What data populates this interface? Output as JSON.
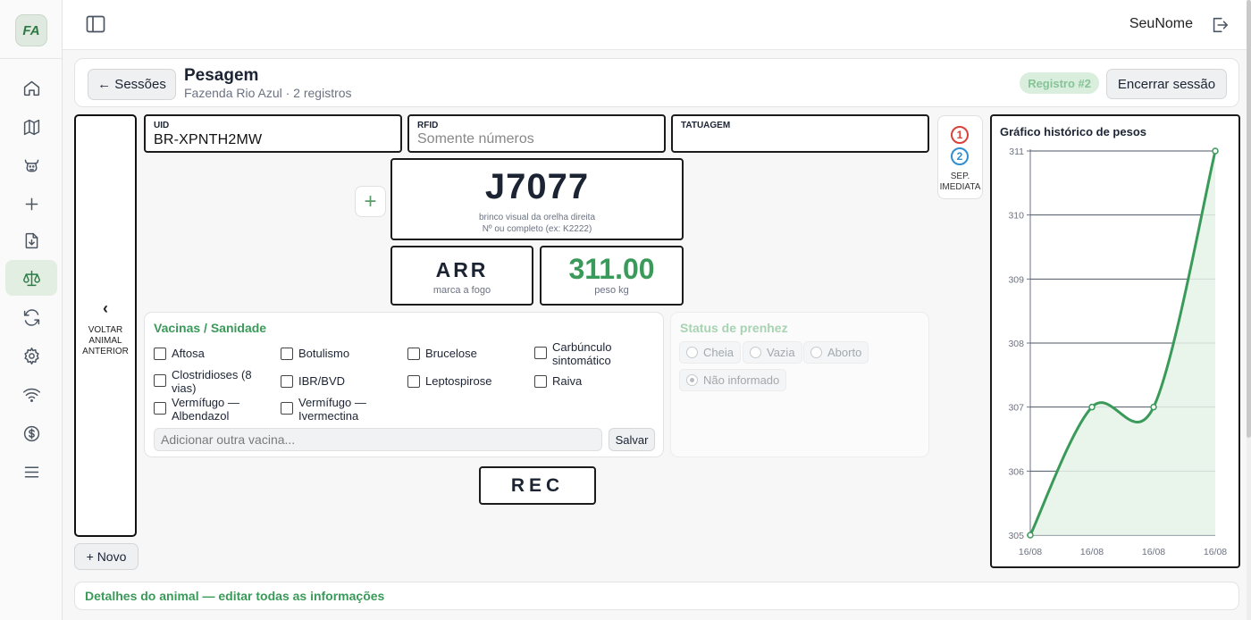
{
  "app": {
    "logo_text": "FA",
    "user_name": "SeuNome"
  },
  "sidebar": {
    "items": [
      {
        "icon": "home-icon"
      },
      {
        "icon": "map-icon"
      },
      {
        "icon": "cattle-icon"
      },
      {
        "icon": "plus-icon"
      },
      {
        "icon": "file-download-icon"
      },
      {
        "icon": "scale-icon",
        "active": true
      },
      {
        "icon": "sync-icon"
      },
      {
        "icon": "gear-icon"
      },
      {
        "icon": "wifi-icon"
      },
      {
        "icon": "dollar-icon"
      },
      {
        "icon": "menu-icon"
      }
    ]
  },
  "header": {
    "back_label": "← Sessões",
    "title": "Pesagem",
    "subtitle": "Fazenda Rio Azul · 2 registros",
    "registro_badge": "Registro #2",
    "end_session_label": "Encerrar sessão"
  },
  "nav": {
    "prev_chevron": "‹",
    "prev_label": "Voltar animal anterior",
    "new_label": "+ Novo"
  },
  "fields": {
    "uid_label": "UID",
    "uid_value": "BR-XPNTH2MW",
    "rfid_label": "RFID",
    "rfid_placeholder": "Somente números",
    "tatuagem_label": "TATUAGEM"
  },
  "tag": {
    "plus_label": "+",
    "value": "J7077",
    "caption_line1": "brinco visual da orelha direita",
    "caption_line2": "Nº ou completo (ex: K2222)"
  },
  "brand": {
    "value": "ARR",
    "caption": "marca a fogo"
  },
  "weight": {
    "value": "311.00",
    "caption": "peso kg",
    "color": "#3a9a59"
  },
  "vaccines": {
    "title": "Vacinas / Sanidade",
    "items": [
      {
        "label": "Aftosa",
        "checked": false
      },
      {
        "label": "Botulismo",
        "checked": false
      },
      {
        "label": "Brucelose",
        "checked": false
      },
      {
        "label": "Carbúnculo sintomático",
        "checked": false
      },
      {
        "label": "Clostridioses (8 vias)",
        "checked": false
      },
      {
        "label": "IBR/BVD",
        "checked": false
      },
      {
        "label": "Leptospirose",
        "checked": false
      },
      {
        "label": "Raiva",
        "checked": false
      },
      {
        "label": "Vermífugo — Albendazol",
        "checked": false
      },
      {
        "label": "Vermífugo — Ivermectina",
        "checked": false
      }
    ],
    "add_placeholder": "Adicionar outra vacina...",
    "save_label": "Salvar"
  },
  "pregnancy": {
    "title": "Status de prenhez",
    "options": [
      {
        "label": "Cheia",
        "selected": false
      },
      {
        "label": "Vazia",
        "selected": false
      },
      {
        "label": "Aborto",
        "selected": false
      },
      {
        "label": "Não informado",
        "selected": true
      }
    ]
  },
  "rec_label": "REC",
  "separation": {
    "badge1": "1",
    "badge1_color": "#d9423b",
    "badge2": "2",
    "badge2_color": "#2f8fd1",
    "label": "SEP. IMEDIATA"
  },
  "chart_data": {
    "type": "line",
    "title": "Gráfico histórico de pesos",
    "x": [
      "16/08",
      "16/08",
      "16/08",
      "16/08"
    ],
    "series": [
      {
        "values": [
          305,
          307,
          307,
          311
        ]
      }
    ],
    "ylim": [
      305,
      311
    ],
    "yticks": [
      305,
      306,
      307,
      308,
      309,
      310,
      311
    ],
    "grid": true,
    "line_color": "#3a9a59",
    "fill_color": "#e5f2e8"
  },
  "details_link": "Detalhes do animal — editar todas as informações"
}
